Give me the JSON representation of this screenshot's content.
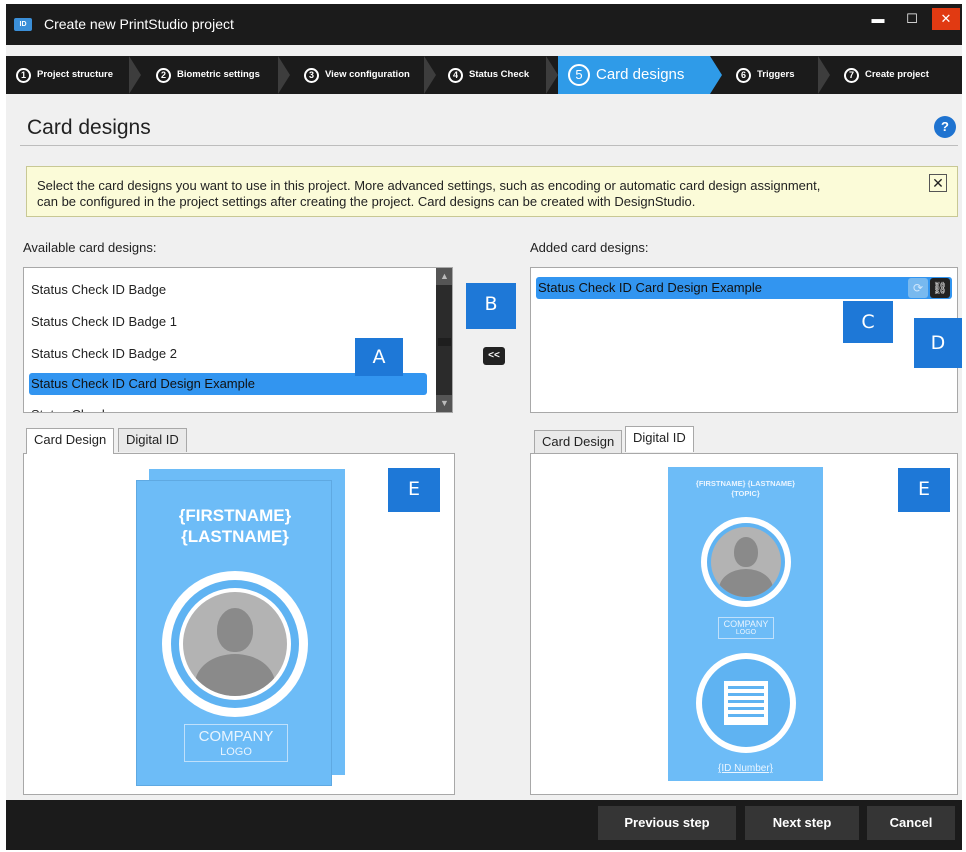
{
  "window": {
    "title": "Create new PrintStudio project",
    "app_icon": "id-card-icon",
    "controls": {
      "minimize": "▬",
      "maximize": "☐",
      "close": "✕"
    }
  },
  "steps": [
    {
      "num": "1",
      "label": "Project structure"
    },
    {
      "num": "2",
      "label": "Biometric settings"
    },
    {
      "num": "3",
      "label": "View configuration"
    },
    {
      "num": "4",
      "label": "Status Check"
    },
    {
      "num": "5",
      "label": "Card designs"
    },
    {
      "num": "6",
      "label": "Triggers"
    },
    {
      "num": "7",
      "label": "Create project"
    }
  ],
  "active_step": "5",
  "page": {
    "title": "Card designs",
    "help": "?",
    "info_line1": "Select the card designs you want to use in this project. More advanced settings, such as encoding or automatic card design assignment,",
    "info_line2": "can be configured in the project settings after creating the project. Card designs can be created with DesignStudio.",
    "info_close": "✕"
  },
  "available": {
    "label": "Available card designs:",
    "items": [
      "Status Check ID Badge",
      "Status Check ID Badge 1",
      "Status Check ID Badge 2",
      "Status Check ID Card Design Example",
      "Status Check"
    ],
    "selected_index": 3
  },
  "added": {
    "label": "Added card designs:",
    "items": [
      "Status Check ID Card Design Example"
    ]
  },
  "move_buttons": {
    "remove": "<<"
  },
  "callouts": {
    "a": "A",
    "b": "B",
    "c": "C",
    "d": "D",
    "e_left": "E",
    "e_right": "E"
  },
  "left_preview": {
    "tabs": [
      "Card Design",
      "Digital ID"
    ],
    "active_tab": "Card Design",
    "card": {
      "firstname": "{FIRSTNAME}",
      "lastname": "{LASTNAME}",
      "company": "COMPANY",
      "logo": "LOGO"
    }
  },
  "right_preview": {
    "tabs": [
      "Card Design",
      "Digital ID"
    ],
    "active_tab": "Digital ID",
    "card": {
      "name_line": "{FIRSTNAME} {LASTNAME}",
      "topic": "{TOPIC}",
      "company": "COMPANY",
      "logo": "LOGO",
      "id_number": "{ID Number}"
    }
  },
  "footer": {
    "previous": "Previous step",
    "next": "Next step",
    "cancel": "Cancel"
  },
  "colors": {
    "accent": "#2f9be8",
    "selection": "#3295f0",
    "callout": "#1e78d7",
    "card": "#6dbcf7",
    "dark": "#1b1b1b"
  }
}
